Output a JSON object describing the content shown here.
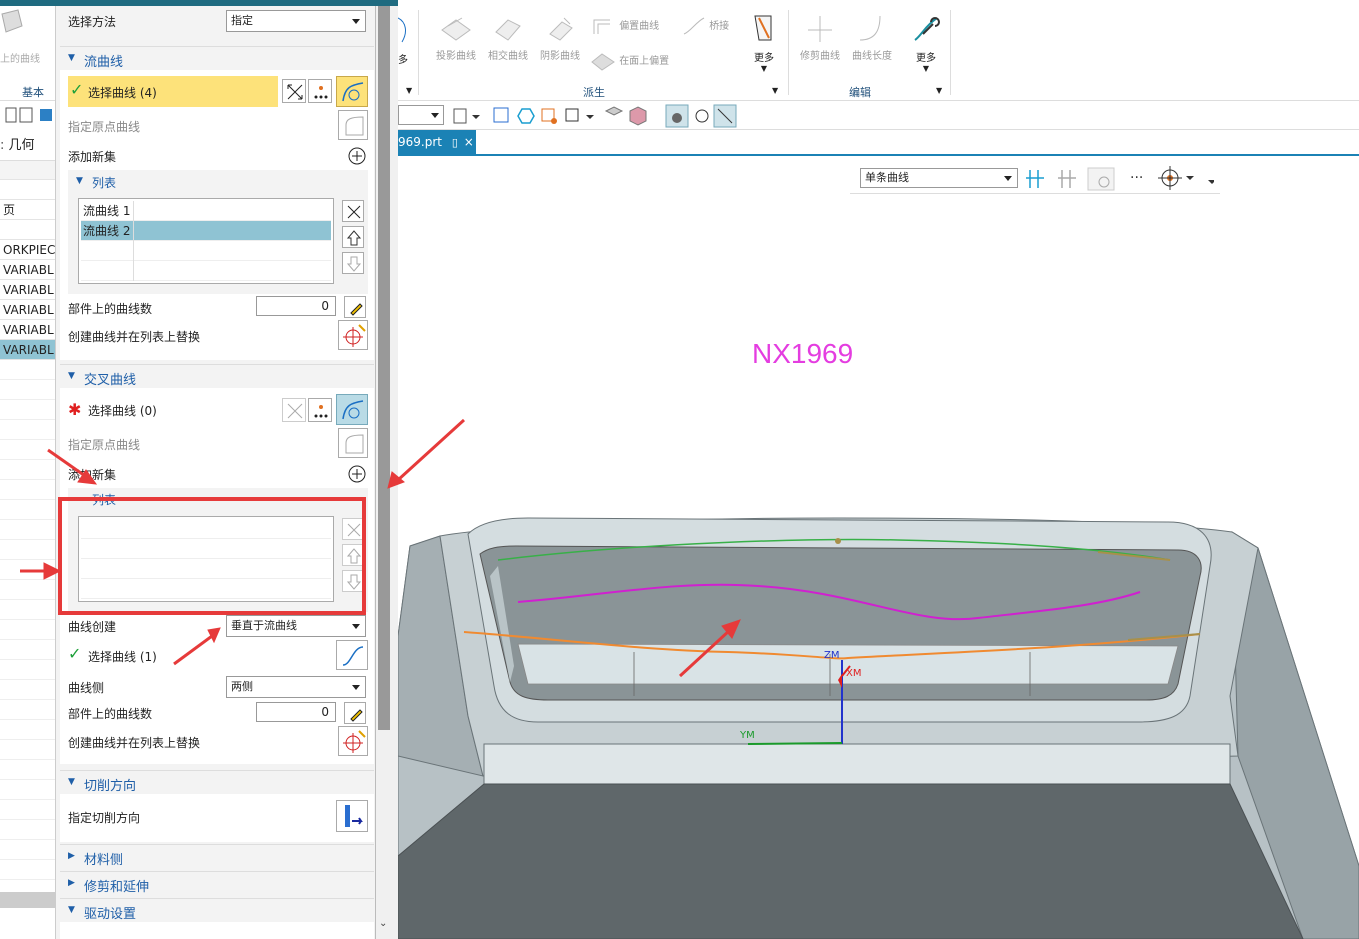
{
  "nav": {
    "header": "几何",
    "rows": [
      "",
      "页",
      "",
      "ORKPIEC",
      "VARIABL",
      "VARIABL",
      "VARIABL",
      "VARIABL",
      "VARIABL"
    ],
    "ribbon_partial_label": "上的曲线",
    "ribbon_group": "基本"
  },
  "dialog": {
    "select_method_label": "选择方法",
    "select_method_value": "指定",
    "flow": {
      "title": "流曲线",
      "select_curve": "选择曲线 (4)",
      "origin_curve": "指定原点曲线",
      "add_set": "添加新集",
      "list_title": "列表",
      "items": [
        "流曲线 1",
        "流曲线 2"
      ],
      "curve_count_label": "部件上的曲线数",
      "curve_count_value": "0",
      "create_replace": "创建曲线并在列表上替换"
    },
    "cross": {
      "title": "交叉曲线",
      "select_curve": "选择曲线 (0)",
      "origin_curve": "指定原点曲线",
      "add_set": "添加新集",
      "list_title": "列表",
      "curve_create_label": "曲线创建",
      "curve_create_value": "垂直于流曲线",
      "select_curve2": "选择曲线 (1)",
      "curve_side_label": "曲线侧",
      "curve_side_value": "两侧",
      "curve_count_label": "部件上的曲线数",
      "curve_count_value": "0",
      "create_replace": "创建曲线并在列表上替换"
    },
    "cut_dir": {
      "title": "切削方向",
      "spec": "指定切削方向"
    },
    "material_side": "材料侧",
    "trim_extend": "修剪和延伸",
    "drive_settings": "驱动设置"
  },
  "ribbon": {
    "more1": "多",
    "buttons": [
      "投影曲线",
      "相交曲线",
      "阴影曲线",
      "偏置曲线",
      "桥接",
      "在面上偏置",
      "更多",
      "修剪曲线",
      "曲线长度",
      "更多"
    ],
    "groups": [
      "派生",
      "编辑"
    ]
  },
  "tab": {
    "label": "969.prt",
    "close": "×"
  },
  "selection": {
    "filter": "单条曲线",
    "more": "···"
  },
  "viewport": {
    "watermark": "NX1969",
    "axis_zm": "ZM",
    "axis_xm": "XM",
    "axis_ym": "YM"
  },
  "colors": {
    "accent": "#1b82b5",
    "highlight": "#fde27a",
    "selected_row": "#8fc3d3",
    "watermark": "#e43de0",
    "annotation": "#e63a3a"
  }
}
